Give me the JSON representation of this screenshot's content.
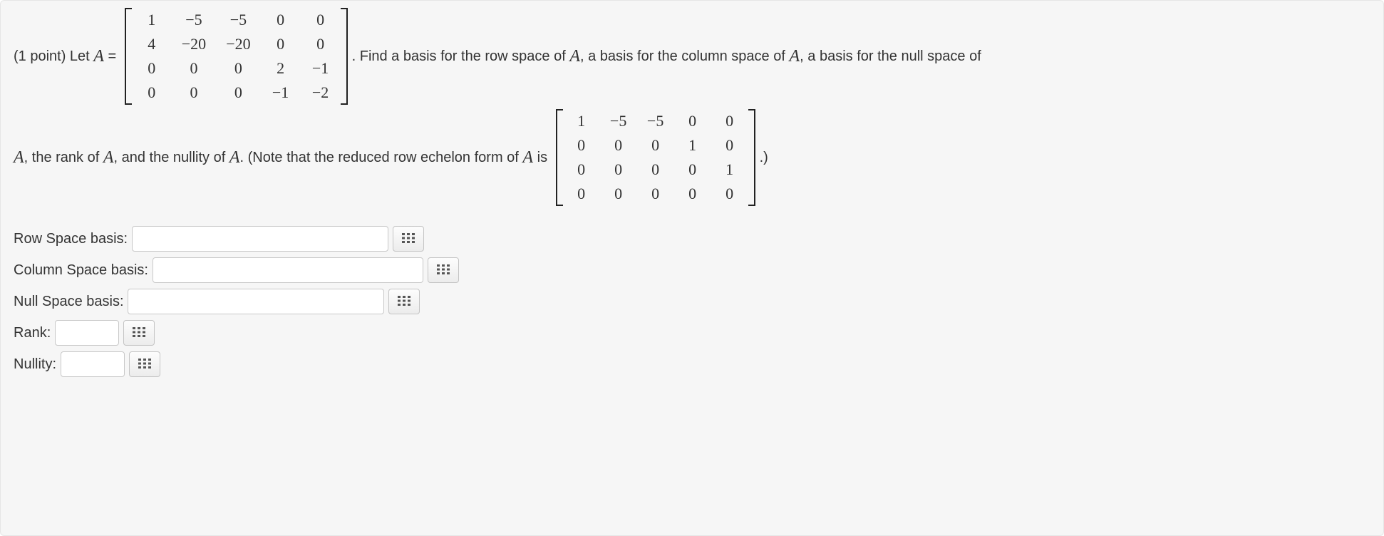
{
  "problem": {
    "points_prefix": "(1 point) Let ",
    "var_A": "A",
    "eq": " = ",
    "matrix_A": [
      [
        "1",
        "−5",
        "−5",
        "0",
        "0"
      ],
      [
        "4",
        "−20",
        "−20",
        "0",
        "0"
      ],
      [
        "0",
        "0",
        "0",
        "2",
        "−1"
      ],
      [
        "0",
        "0",
        "0",
        "−1",
        "−2"
      ]
    ],
    "after_matrix": ". Find a basis for the row space of ",
    "mid1": ", a basis for the column space of ",
    "mid2": ", a basis for the null space of",
    "line2_pre": ", the rank of ",
    "line2_mid": ", and the nullity of ",
    "line2_note": ". (Note that the reduced row echelon form of ",
    "line2_is": " is ",
    "rref": [
      [
        "1",
        "−5",
        "−5",
        "0",
        "0"
      ],
      [
        "0",
        "0",
        "0",
        "1",
        "0"
      ],
      [
        "0",
        "0",
        "0",
        "0",
        "1"
      ],
      [
        "0",
        "0",
        "0",
        "0",
        "0"
      ]
    ],
    "line2_end": ".)"
  },
  "answers": {
    "row_space_label": "Row Space basis: ",
    "col_space_label": "Column Space basis: ",
    "null_space_label": "Null Space basis: ",
    "rank_label": "Rank: ",
    "nullity_label": "Nullity: ",
    "row_space_value": "",
    "col_space_value": "",
    "null_space_value": "",
    "rank_value": "",
    "nullity_value": ""
  },
  "chart_data": {
    "type": "table",
    "title": "Matrix A and its reduced row echelon form",
    "matrices": {
      "A": [
        [
          1,
          -5,
          -5,
          0,
          0
        ],
        [
          4,
          -20,
          -20,
          0,
          0
        ],
        [
          0,
          0,
          0,
          2,
          -1
        ],
        [
          0,
          0,
          0,
          -1,
          -2
        ]
      ],
      "rref_A": [
        [
          1,
          -5,
          -5,
          0,
          0
        ],
        [
          0,
          0,
          0,
          1,
          0
        ],
        [
          0,
          0,
          0,
          0,
          1
        ],
        [
          0,
          0,
          0,
          0,
          0
        ]
      ]
    }
  }
}
